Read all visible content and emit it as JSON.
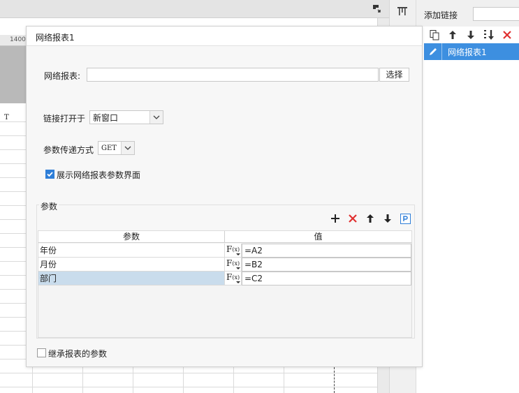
{
  "ruler": {
    "tick": "1400"
  },
  "sheet": {
    "cell_t": "T"
  },
  "right_panel": {
    "add_link_label": "添加链接",
    "items": [
      {
        "label": "网络报表1"
      }
    ]
  },
  "dialog": {
    "title": "网络报表1",
    "report_label": "网络报表:",
    "report_value": "",
    "select_button": "选择",
    "link_open_label": "链接打开于",
    "link_open_value": "新窗口",
    "param_method_label": "参数传递方式",
    "param_method_value": "GET",
    "show_params_label": "展示网络报表参数界面",
    "show_params_checked": true,
    "params_group": "参数",
    "table": {
      "col_param": "参数",
      "col_value": "值",
      "fx_label": "F",
      "fx_sub": "(x)",
      "rows": [
        {
          "name": "年份",
          "value": "=A2"
        },
        {
          "name": "月份",
          "value": "=B2"
        },
        {
          "name": "部门",
          "value": "=C2"
        }
      ]
    },
    "inherit_label": "继承报表的参数",
    "inherit_checked": false
  },
  "colors": {
    "accent": "#3d8fe0",
    "delete_red": "#e03030",
    "selected_row": "#c9dcec",
    "checkbox_on": "#2f7fd8"
  }
}
